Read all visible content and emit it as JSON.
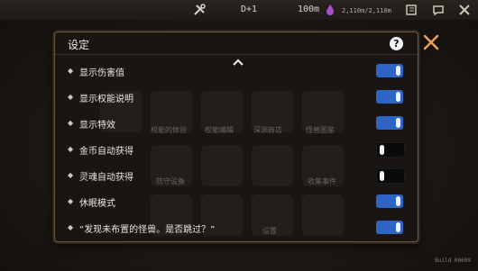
{
  "topbar": {
    "day_label": "D+1",
    "depth_label": "100m",
    "resource_label": "2,110m/2,110m"
  },
  "dialog": {
    "title": "设定",
    "help_label": "?",
    "settings": [
      {
        "label": "显示伤害值",
        "enabled": true
      },
      {
        "label": "显示权能说明",
        "enabled": true
      },
      {
        "label": "显示特效",
        "enabled": true
      },
      {
        "label": "金币自动获得",
        "enabled": false
      },
      {
        "label": "灵魂自动获得",
        "enabled": false
      },
      {
        "label": "休眠模式",
        "enabled": true
      },
      {
        "label": "“发现未布置的怪兽。是否跳过？”",
        "enabled": true
      }
    ]
  },
  "background_labels": [
    "权能的体验",
    "防守设备",
    "权能编辑",
    "深渊商店",
    "怪兽图鉴",
    "收集事件",
    "设置"
  ],
  "build_label": "Build 00609",
  "colors": {
    "toggle_on": "#2e64c4",
    "toggle_off": "#0a0a0a",
    "close_x": "#e8a25a",
    "dialog_border": "#6f5a45"
  }
}
